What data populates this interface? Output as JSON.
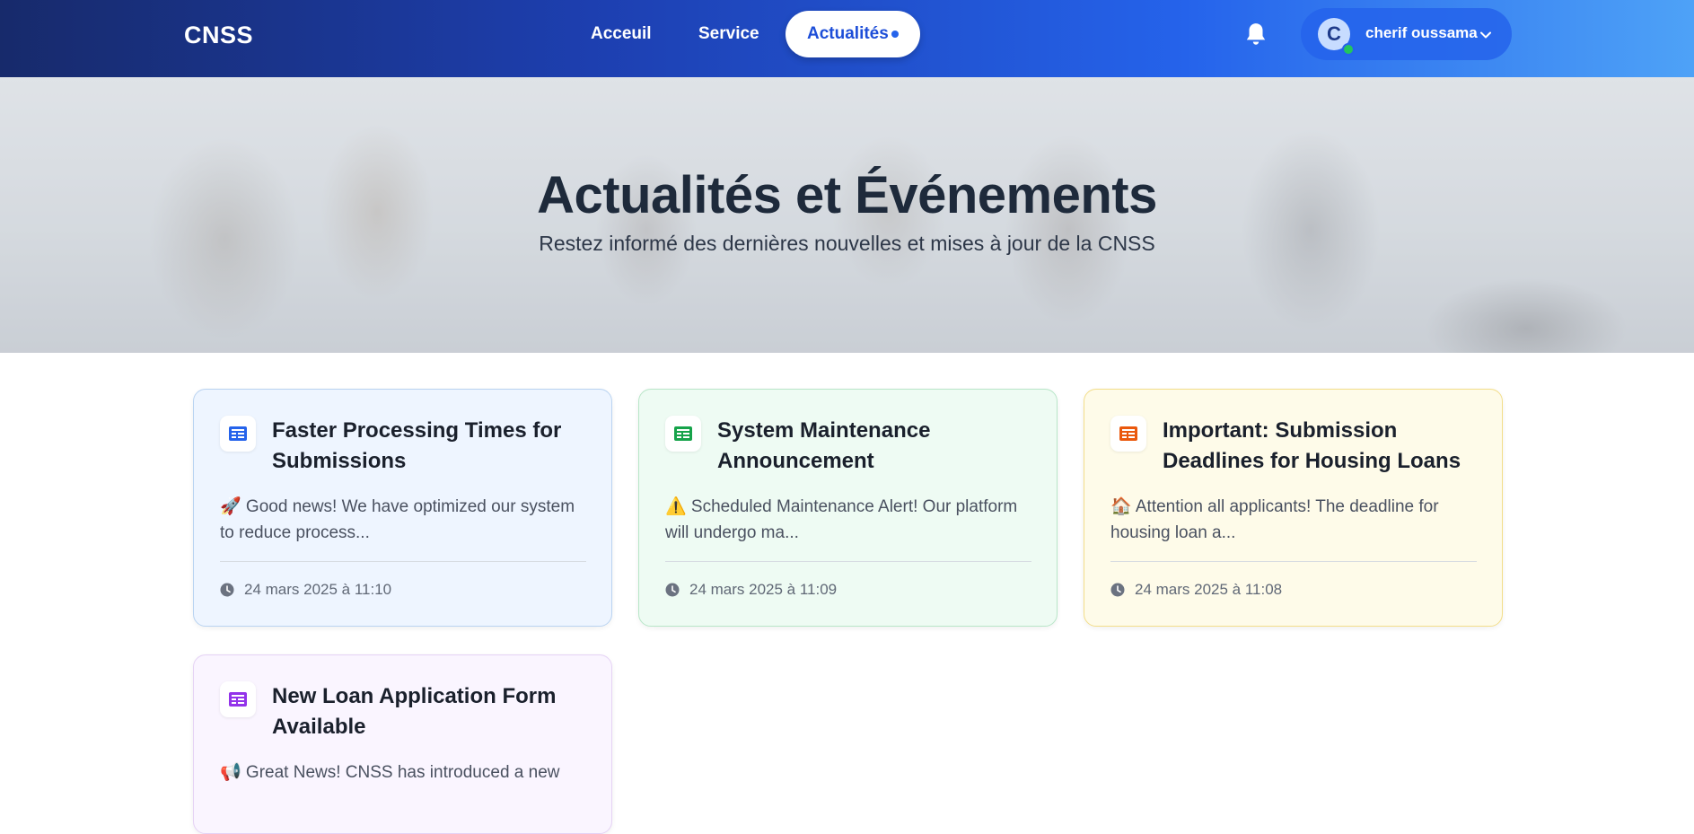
{
  "nav": {
    "logo": "CNSS",
    "links": [
      "Acceuil",
      "Service"
    ],
    "active_link": "Actualités",
    "user": {
      "initial": "C",
      "name": "cherif oussama"
    }
  },
  "hero": {
    "title": "Actualités et Événements",
    "subtitle": "Restez informé des dernières nouvelles et mises à jour de la CNSS"
  },
  "cards": [
    {
      "title": "Faster Processing Times for Submissions",
      "excerpt": "🚀 Good news! We have optimized our system to reduce process...",
      "date": "24 mars 2025 à 11:10",
      "accent": "#2563eb"
    },
    {
      "title": "System Maintenance Announcement",
      "excerpt": "⚠️ Scheduled Maintenance Alert! Our platform will undergo ma...",
      "date": "24 mars 2025 à 11:09",
      "accent": "#16a34a"
    },
    {
      "title": "Important: Submission Deadlines for Housing Loans",
      "excerpt": "🏠 Attention all applicants! The deadline for housing loan a...",
      "date": "24 mars 2025 à 11:08",
      "accent": "#ea580c"
    },
    {
      "title": "New Loan Application Form Available",
      "excerpt": "📢 Great News! CNSS has introduced a new",
      "date": "",
      "accent": "#9333ea"
    }
  ],
  "icons": {
    "notifications": "bell-icon",
    "user_menu": "chevron-down-icon",
    "card": "newspaper-icon",
    "date": "clock-icon"
  }
}
